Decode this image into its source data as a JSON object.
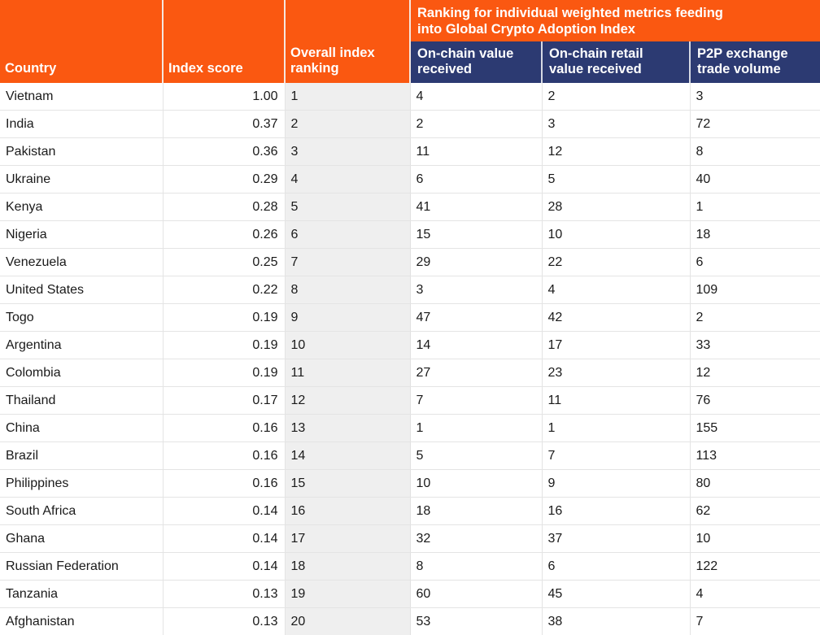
{
  "table": {
    "headers": {
      "country": "Country",
      "index_score": "Index score",
      "overall_rank": "Overall index\nranking",
      "overall_rank_line1": "Overall index",
      "overall_rank_line2": "ranking",
      "group_title_line1": "Ranking for individual weighted metrics feeding",
      "group_title_line2": "into Global Crypto Adoption Index",
      "metric1_line1": "On-chain value",
      "metric1_line2": "received",
      "metric2_line1": "On-chain retail",
      "metric2_line2": "value received",
      "metric3_line1": "P2P exchange",
      "metric3_line2": "trade volume"
    },
    "colors": {
      "header_orange": "#fa5811",
      "header_blue": "#2c3a72",
      "rank_column_bg": "#efefef",
      "grid_line": "#e4e4e4",
      "header_text": "#ffffff",
      "body_text": "#1a1a1a"
    },
    "rows": [
      {
        "country": "Vietnam",
        "index_score": "1.00",
        "overall_rank": "1",
        "onchain_value": "4",
        "onchain_retail": "2",
        "p2p_volume": "3"
      },
      {
        "country": "India",
        "index_score": "0.37",
        "overall_rank": "2",
        "onchain_value": "2",
        "onchain_retail": "3",
        "p2p_volume": "72"
      },
      {
        "country": "Pakistan",
        "index_score": "0.36",
        "overall_rank": "3",
        "onchain_value": "11",
        "onchain_retail": "12",
        "p2p_volume": "8"
      },
      {
        "country": "Ukraine",
        "index_score": "0.29",
        "overall_rank": "4",
        "onchain_value": "6",
        "onchain_retail": "5",
        "p2p_volume": "40"
      },
      {
        "country": "Kenya",
        "index_score": "0.28",
        "overall_rank": "5",
        "onchain_value": "41",
        "onchain_retail": "28",
        "p2p_volume": "1"
      },
      {
        "country": "Nigeria",
        "index_score": "0.26",
        "overall_rank": "6",
        "onchain_value": "15",
        "onchain_retail": "10",
        "p2p_volume": "18"
      },
      {
        "country": "Venezuela",
        "index_score": "0.25",
        "overall_rank": "7",
        "onchain_value": "29",
        "onchain_retail": "22",
        "p2p_volume": "6"
      },
      {
        "country": "United States",
        "index_score": "0.22",
        "overall_rank": "8",
        "onchain_value": "3",
        "onchain_retail": "4",
        "p2p_volume": "109"
      },
      {
        "country": "Togo",
        "index_score": "0.19",
        "overall_rank": "9",
        "onchain_value": "47",
        "onchain_retail": "42",
        "p2p_volume": "2"
      },
      {
        "country": "Argentina",
        "index_score": "0.19",
        "overall_rank": "10",
        "onchain_value": "14",
        "onchain_retail": "17",
        "p2p_volume": "33"
      },
      {
        "country": "Colombia",
        "index_score": "0.19",
        "overall_rank": "11",
        "onchain_value": "27",
        "onchain_retail": "23",
        "p2p_volume": "12"
      },
      {
        "country": "Thailand",
        "index_score": "0.17",
        "overall_rank": "12",
        "onchain_value": "7",
        "onchain_retail": "11",
        "p2p_volume": "76"
      },
      {
        "country": "China",
        "index_score": "0.16",
        "overall_rank": "13",
        "onchain_value": "1",
        "onchain_retail": "1",
        "p2p_volume": "155"
      },
      {
        "country": "Brazil",
        "index_score": "0.16",
        "overall_rank": "14",
        "onchain_value": "5",
        "onchain_retail": "7",
        "p2p_volume": "113"
      },
      {
        "country": "Philippines",
        "index_score": "0.16",
        "overall_rank": "15",
        "onchain_value": "10",
        "onchain_retail": "9",
        "p2p_volume": "80"
      },
      {
        "country": "South Africa",
        "index_score": "0.14",
        "overall_rank": "16",
        "onchain_value": "18",
        "onchain_retail": "16",
        "p2p_volume": "62"
      },
      {
        "country": "Ghana",
        "index_score": "0.14",
        "overall_rank": "17",
        "onchain_value": "32",
        "onchain_retail": "37",
        "p2p_volume": "10"
      },
      {
        "country": "Russian Federation",
        "index_score": "0.14",
        "overall_rank": "18",
        "onchain_value": "8",
        "onchain_retail": "6",
        "p2p_volume": "122"
      },
      {
        "country": "Tanzania",
        "index_score": "0.13",
        "overall_rank": "19",
        "onchain_value": "60",
        "onchain_retail": "45",
        "p2p_volume": "4"
      },
      {
        "country": "Afghanistan",
        "index_score": "0.13",
        "overall_rank": "20",
        "onchain_value": "53",
        "onchain_retail": "38",
        "p2p_volume": "7"
      }
    ]
  }
}
